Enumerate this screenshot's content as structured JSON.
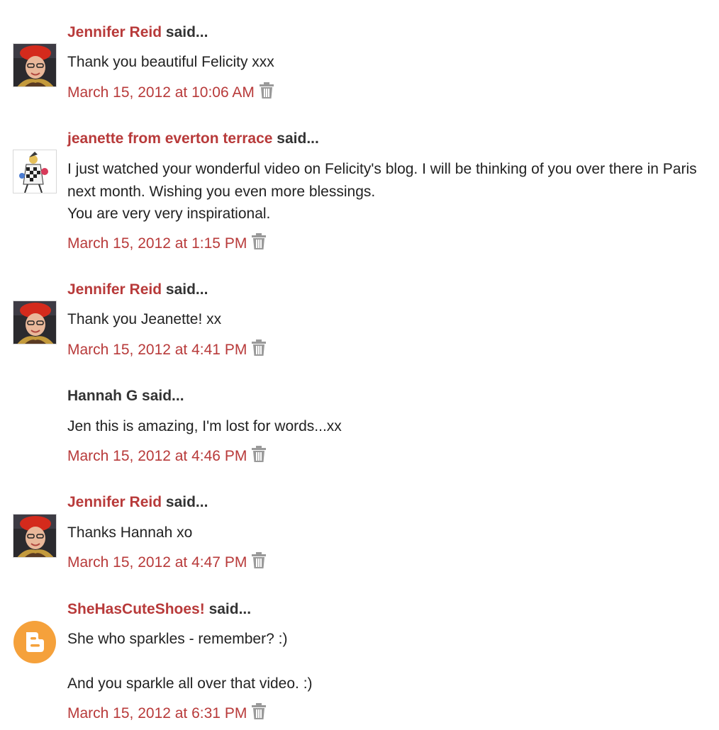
{
  "said_suffix": "said...",
  "comments": [
    {
      "author": "Jennifer Reid",
      "author_linked": true,
      "avatar": "jennifer-photo",
      "lines": [
        "Thank you beautiful Felicity xxx"
      ],
      "timestamp": "March 15, 2012 at 10:06 AM"
    },
    {
      "author": "jeanette from everton terrace",
      "author_linked": true,
      "avatar": "jeanette-illustration",
      "lines": [
        "I just watched your wonderful video on Felicity's blog. I will be thinking of you over there in Paris next month. Wishing you even more blessings.",
        "You are very very inspirational."
      ],
      "timestamp": "March 15, 2012 at 1:15 PM"
    },
    {
      "author": "Jennifer Reid",
      "author_linked": true,
      "avatar": "jennifer-photo",
      "lines": [
        "Thank you Jeanette! xx"
      ],
      "timestamp": "March 15, 2012 at 4:41 PM"
    },
    {
      "author": "Hannah G",
      "author_linked": false,
      "avatar": "none",
      "lines": [
        "Jen this is amazing, I'm lost for words...xx"
      ],
      "timestamp": "March 15, 2012 at 4:46 PM"
    },
    {
      "author": "Jennifer Reid",
      "author_linked": true,
      "avatar": "jennifer-photo",
      "lines": [
        "Thanks Hannah xo"
      ],
      "timestamp": "March 15, 2012 at 4:47 PM"
    },
    {
      "author": "SheHasCuteShoes!",
      "author_linked": true,
      "avatar": "blogger-icon",
      "lines": [
        "She who sparkles - remember? :)",
        "",
        "And you sparkle all over that video. :)"
      ],
      "timestamp": "March 15, 2012 at 6:31 PM"
    }
  ],
  "colors": {
    "link": "#b83a3a",
    "text": "#222222",
    "trash_icon": "#9a9a9a",
    "blogger_orange": "#f5a13b"
  },
  "icons": {
    "delete": "trash-icon"
  }
}
